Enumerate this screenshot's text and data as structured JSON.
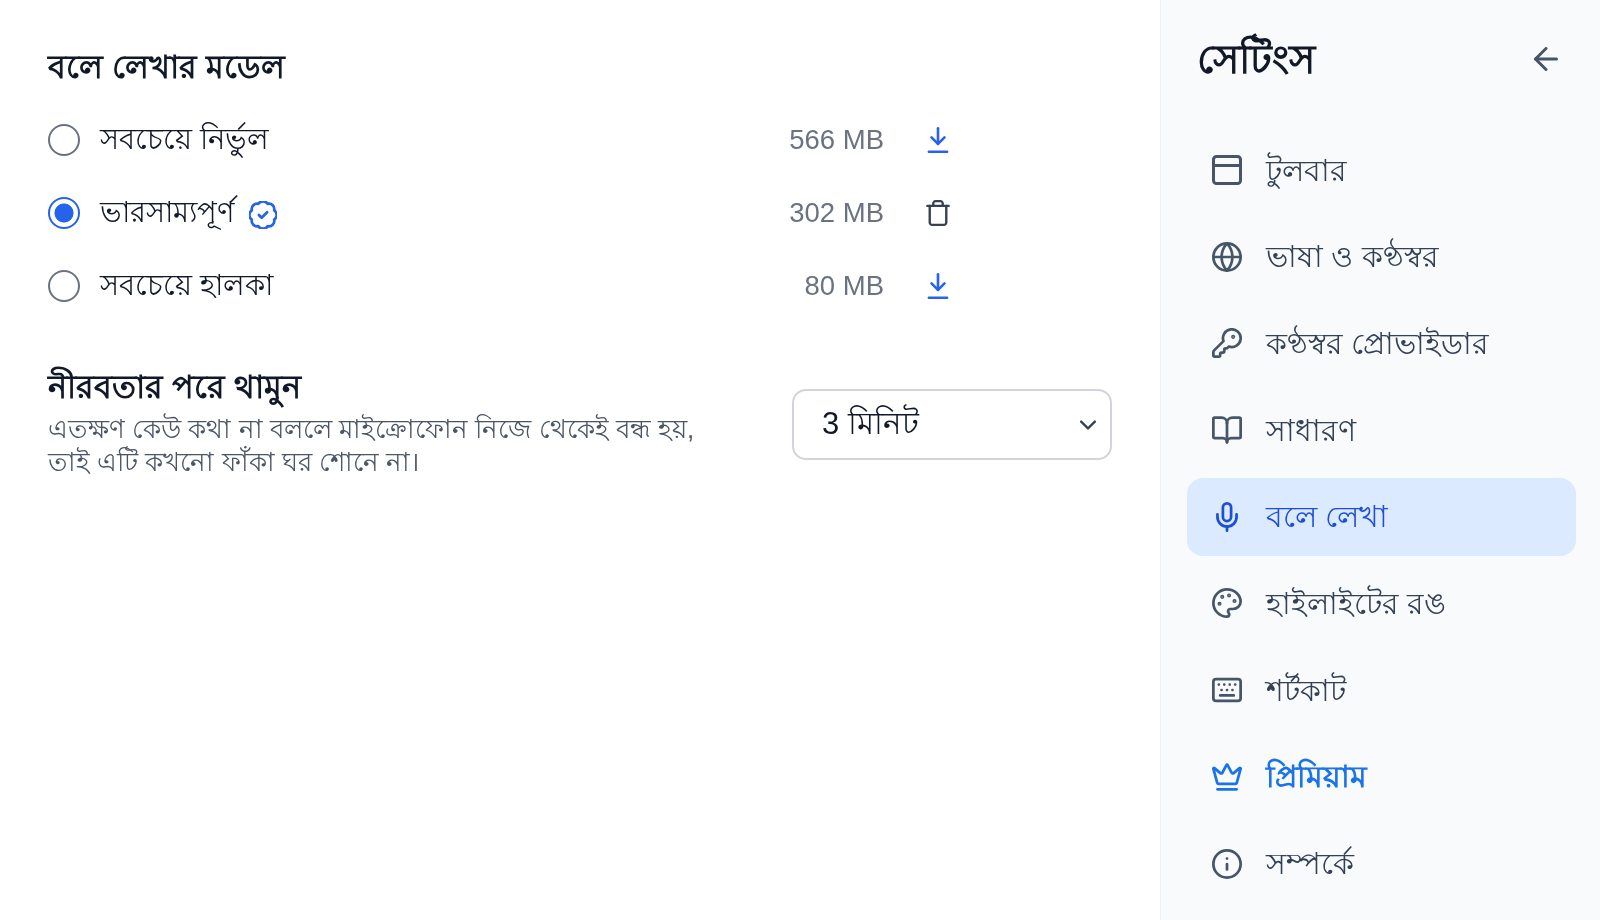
{
  "dictation_model": {
    "heading": "বলে লেখার মডেল",
    "models": [
      {
        "label": "সবচেয়ে নির্ভুল",
        "size": "566 MB",
        "selected": false,
        "recommended": false,
        "downloaded": false
      },
      {
        "label": "ভারসাম্যপূর্ণ",
        "size": "302 MB",
        "selected": true,
        "recommended": true,
        "downloaded": true
      },
      {
        "label": "সবচেয়ে হালকা",
        "size": "80 MB",
        "selected": false,
        "recommended": false,
        "downloaded": false
      }
    ]
  },
  "silence_stop": {
    "heading": "নীরবতার পরে থামুন",
    "description": "এতক্ষণ কেউ কথা না বললে মাইক্রোফোন নিজে থেকেই বন্ধ হয়, তাই এটি কখনো ফাঁকা ঘর শোনে না।",
    "select": {
      "value": "3 মিনিট"
    }
  },
  "sidebar": {
    "title": "সেটিংস",
    "items": [
      {
        "label": "টুলবার",
        "kind": "page",
        "selected": false
      },
      {
        "label": "ভাষা ও কণ্ঠস্বর",
        "kind": "page",
        "selected": false
      },
      {
        "label": "কণ্ঠস্বর প্রোভাইডার",
        "kind": "page",
        "selected": false
      },
      {
        "label": "সাধারণ",
        "kind": "page",
        "selected": false
      },
      {
        "label": "বলে লেখা",
        "kind": "page",
        "selected": true
      },
      {
        "label": "হাইলাইটের রঙ",
        "kind": "page",
        "selected": false
      },
      {
        "label": "শর্টকাট",
        "kind": "page",
        "selected": false
      },
      {
        "label": "প্রিমিয়াম",
        "kind": "premium",
        "selected": false
      },
      {
        "label": "সম্পর্কে",
        "kind": "page",
        "selected": false
      }
    ]
  }
}
